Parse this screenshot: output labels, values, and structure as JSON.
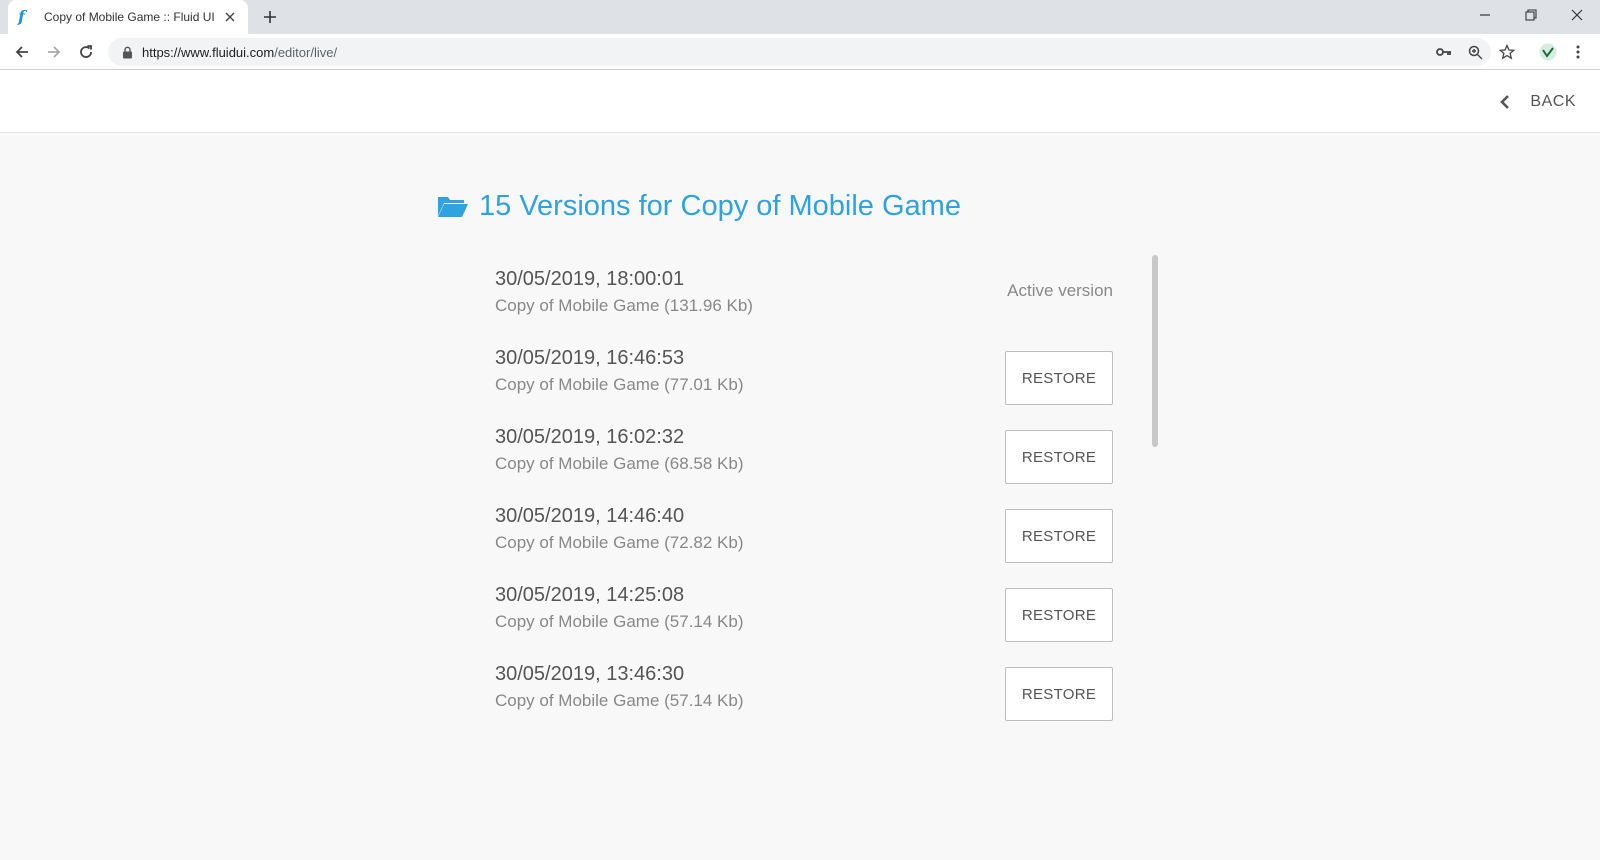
{
  "browser": {
    "tab_title": "Copy of Mobile Game :: Fluid UI",
    "url_host": "https://www.fluidui.com",
    "url_path": "/editor/live/"
  },
  "header": {
    "back_label": "BACK"
  },
  "page": {
    "heading": "15 Versions for Copy of Mobile Game",
    "accent_color": "#2fa2e0"
  },
  "versions": [
    {
      "timestamp": "30/05/2019, 18:00:01",
      "meta": "Copy of Mobile Game (131.96 Kb)",
      "status": "Active version"
    },
    {
      "timestamp": "30/05/2019, 16:46:53",
      "meta": "Copy of Mobile Game (77.01 Kb)",
      "action": "RESTORE"
    },
    {
      "timestamp": "30/05/2019, 16:02:32",
      "meta": "Copy of Mobile Game (68.58 Kb)",
      "action": "RESTORE"
    },
    {
      "timestamp": "30/05/2019, 14:46:40",
      "meta": "Copy of Mobile Game (72.82 Kb)",
      "action": "RESTORE"
    },
    {
      "timestamp": "30/05/2019, 14:25:08",
      "meta": "Copy of Mobile Game (57.14 Kb)",
      "action": "RESTORE"
    },
    {
      "timestamp": "30/05/2019, 13:46:30",
      "meta": "Copy of Mobile Game (57.14 Kb)",
      "action": "RESTORE"
    }
  ]
}
